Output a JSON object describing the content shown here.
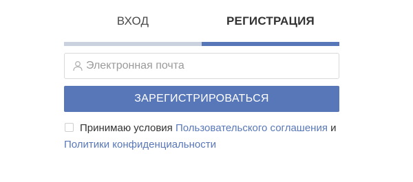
{
  "tabs": {
    "login": "ВХОД",
    "register": "РЕГИСТРАЦИЯ",
    "active": "register"
  },
  "email": {
    "placeholder": "Электронная почта",
    "value": "",
    "icon": "user-icon"
  },
  "submit": {
    "label": "ЗАРЕГИСТРИРОВАТЬСЯ"
  },
  "terms": {
    "checked": false,
    "prefix": "Принимаю условия",
    "agreement_link": "Пользовательского соглашения",
    "conjunction": "и",
    "privacy_link": "Политики конфиденциальности"
  },
  "colors": {
    "accent": "#5877b8",
    "inactive_tab_bar": "#c9d2de",
    "text": "#333333",
    "placeholder": "#9a9a9a"
  }
}
